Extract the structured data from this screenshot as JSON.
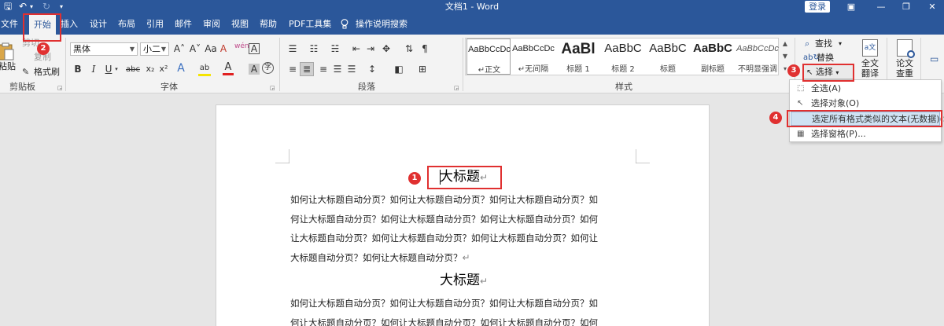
{
  "titlebar": {
    "title": "文档1  -  Word",
    "login_label": "登录",
    "save_glyph": "🖫",
    "undo_glyph": "↶",
    "undo_more": "▾",
    "redo_glyph": "↻",
    "customize_glyph": "▾",
    "ribbon_opts_glyph": "▣",
    "min_glyph": "—",
    "max_glyph": "❐",
    "close_glyph": "✕"
  },
  "tabs": [
    "文件",
    "开始",
    "插入",
    "设计",
    "布局",
    "引用",
    "邮件",
    "审阅",
    "视图",
    "帮助",
    "PDF工具集",
    "操作说明搜索"
  ],
  "active_tab": "开始",
  "clipboard": {
    "paste_label": "粘贴",
    "cut_label": "剪切",
    "copy_label": "复制",
    "format_painter_label": "格式刷",
    "group_label": "剪贴板"
  },
  "font": {
    "font_name": "黑体",
    "font_size": "小二",
    "grow": "A˄",
    "shrink": "A˅",
    "change_case": "Aa",
    "clear_format": "A",
    "phonetic": "wén",
    "char_border": "A",
    "bold": "B",
    "italic": "I",
    "underline": "U",
    "strikethrough": "abc",
    "subscript": "x₂",
    "superscript": "x²",
    "text_effects": "A",
    "highlight": "ab",
    "font_color": "A",
    "char_shading": "A",
    "circle_char": "字",
    "group_label": "字体"
  },
  "paragraph": {
    "group_label": "段落",
    "row1": [
      "☰",
      "☷",
      "☵",
      "⇤",
      "⇥",
      "✥",
      "⇅",
      "¶"
    ],
    "row2": [
      "≡",
      "≣",
      "≡",
      "☰",
      "☰",
      "↕",
      "◧",
      "⊞"
    ]
  },
  "styles": {
    "group_label": "样式",
    "items": [
      {
        "preview": "AaBbCcDc",
        "name": "↵正文"
      },
      {
        "preview": "AaBbCcDc",
        "name": "↵无间隔"
      },
      {
        "preview": "AaBl",
        "name": "标题 1"
      },
      {
        "preview": "AaBbC",
        "name": "标题 2"
      },
      {
        "preview": "AaBbC",
        "name": "标题"
      },
      {
        "preview": "AaBbC",
        "name": "副标题"
      },
      {
        "preview": "AaBbCcDc",
        "name": "不明显强调"
      }
    ]
  },
  "editing": {
    "find_label": "查找",
    "replace_label": "替换",
    "select_label": "选择",
    "translate_label_1": "全文",
    "translate_label_2": "翻译",
    "paper_label_1": "论文",
    "paper_label_2": "查重"
  },
  "select_menu": {
    "items": [
      "全选(A)",
      "选择对象(O)",
      "选定所有格式类似的文本(无数据)(S)",
      "选择窗格(P)..."
    ]
  },
  "document": {
    "heading_1": "大标题",
    "heading_2": "大标题",
    "paragraph_1": [
      "如何让大标题自动分页？如何让大标题自动分页？如何让大标题自动分页？如",
      "何让大标题自动分页？如何让大标题自动分页？如何让大标题自动分页？如何",
      "让大标题自动分页？如何让大标题自动分页？如何让大标题自动分页？如何让",
      "大标题自动分页？如何让大标题自动分页？"
    ],
    "paragraph_2": [
      "如何让大标题自动分页？如何让大标题自动分页？如何让大标题自动分页？如",
      "何让大标题自动分页？如何让大标题自动分页？如何让大标题自动分页？如何"
    ],
    "return_mark": "↵"
  },
  "annotations": [
    "1",
    "2",
    "3",
    "4"
  ],
  "colors": {
    "titlebar": "#2b579a",
    "annotation_red": "#e03030",
    "highlight_blue": "#cfe2f3"
  }
}
